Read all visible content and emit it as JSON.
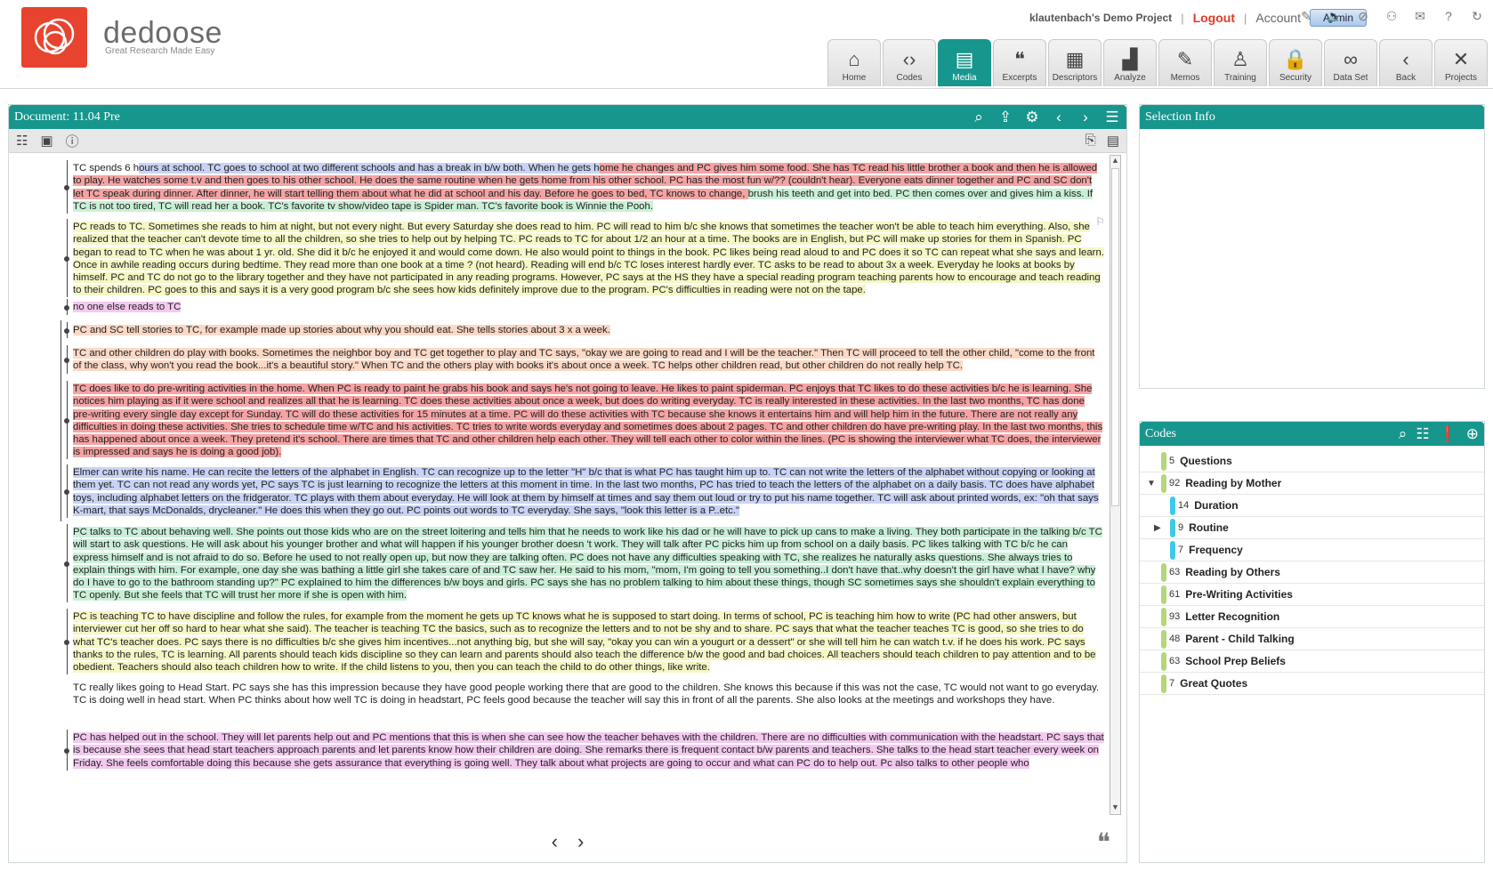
{
  "app": {
    "brand": "dedoose",
    "tagline": "Great Research Made Easy",
    "project": "klautenbach's Demo Project",
    "logout": "Logout",
    "account": "Account",
    "admin": "Admin",
    "accent_color": "#17968d",
    "logo_color": "#e8432f"
  },
  "nav": {
    "tabs": [
      {
        "label": "Home",
        "icon": "home-icon",
        "glyph": "⌂"
      },
      {
        "label": "Codes",
        "icon": "code-brackets-icon",
        "glyph": "‹›"
      },
      {
        "label": "Media",
        "icon": "media-icon",
        "glyph": "▤"
      },
      {
        "label": "Excerpts",
        "icon": "quote-icon",
        "glyph": "❝"
      },
      {
        "label": "Descriptors",
        "icon": "clipboard-icon",
        "glyph": "▦"
      },
      {
        "label": "Analyze",
        "icon": "bar-chart-icon",
        "glyph": "▟"
      },
      {
        "label": "Memos",
        "icon": "memo-icon",
        "glyph": "✎"
      },
      {
        "label": "Training",
        "icon": "person-icon",
        "glyph": "♙"
      },
      {
        "label": "Security",
        "icon": "lock-icon",
        "glyph": "🔒"
      },
      {
        "label": "Data Set",
        "icon": "binoculars-icon",
        "glyph": "∞"
      },
      {
        "label": "Back",
        "icon": "back-arrow-icon",
        "glyph": "‹"
      },
      {
        "label": "Projects",
        "icon": "projects-icon",
        "glyph": "✕"
      }
    ]
  },
  "document": {
    "title": "Document: 11.04 Pre",
    "paragraphs": [
      {
        "segments": [
          {
            "t": "TC spends 6 h",
            "c": "none"
          },
          {
            "t": "ours at school.  TC goes to school at two different schools and has a break in b/w both.  When he gets h",
            "c": "#c8d3f5"
          },
          {
            "t": "ome he changes and PC gives him some food.  She has TC read his little brother a book and then he is allowed to play.  He watches some t.v and then goes to his other school.  He does the same routine when he gets home from his other school.  PC has the most fun w/?? (couldn't hear).  Everyone eats dinner together and PC and SC don't let TC speak during dinner.  After dinner, he will start telling them about what he did at school and his day.  Before he goes to bed, TC knows to change, ",
            "c": "#f5a3a3"
          },
          {
            "t": "brush his teeth and get into bed.  PC then comes over and gives him a kiss.  If TC is not too tired, TC will read her a book.  TC's favorite tv show/video tape is Spider man.  TC's favorite book is Winnie the Pooh.",
            "c": "#c9f0d6"
          }
        ]
      },
      {
        "segments": [
          {
            "t": "PC reads to TC.  Sometimes she reads to him at night,  but not every night.  But every Saturday she does read to him.  PC will read to him b/c she knows that sometimes the teacher won't be able to teach him everything.  Also, she realized that the teacher can't devote time to all the children, so she tries to help out by helping TC.  PC reads to TC for about 1/2 an hour at a time.  The books are in English, but PC will make up stories for them in Spanish.  PC began to read to TC when he was about 1 yr. old.  She did it b/c he enjoyed it and would come down.  He also would point to things in the book.  PC likes being read aloud to and PC does it so TC can repeat what she says and learn.  Once in awhile reading occurs during bedtime.  They read more than one book at a time ? (not heard).  Reading will end b/c TC loses interest hardly ever.  TC asks to be read to about 3x a week.  Everyday he looks at books by himself.  PC and TC do not go to the library together and they have not participated in any reading programs.  However, PC says at the HS they have a special reading program teaching parents how to encourage and teach reading to their children.  PC goes to this and says it is a very good program b/c she sees how kids definitely improve due to the program.  PC's difficulties in reading were not on the tape.",
            "c": "#f6f7c4"
          }
        ]
      },
      {
        "segments": [
          {
            "t": "no one else reads to TC",
            "c": "#f3c9f0"
          }
        ]
      },
      {
        "segments": [
          {
            "t": "PC and SC tell stories to TC, for example made up stories about why you should eat.  She tells stories about 3 x a week.",
            "c": "#fbd9c6"
          }
        ]
      },
      {
        "segments": [
          {
            "t": "TC and other children do play with books.  Sometimes the neighbor boy and TC get together to play and TC says, \"okay we are going to read and I will be the teacher.\"  Then TC will proceed to tell the other child, \"come to the front of the class, why won't you read the book...it's a beautiful story.\"  When TC and the others play with books it's about once a week.  TC helps other children read, but other children do not really help TC.",
            "c": "#fbd9c6"
          }
        ]
      },
      {
        "segments": [
          {
            "t": "TC does like to do pre-writing activities in the home.  When PC is ready to paint he grabs his book and says he's not going to leave.  He likes to paint spiderman.  PC enjoys that TC likes to do these activities b/c he is learning.  She notices him playing as if it were school and realizes all that he is learning.  TC does these activities about once a week, but does do writing everyday.  TC is really interested in these activities.  In the last two months, TC has done pre-writing every single day except for Sunday.  TC will do these activities for 15 minutes at a time.  PC will do these activities with TC because she knows it entertains him and will help him in the future.  There are not really any difficulties in doing these activities.  She tries to schedule time w/TC and his activities.  TC tries to write words everyday and sometimes does about 2 pages.  TC and other children do have pre-writing play.  In the last two months, this has happened about once a week.  They pretend it's school.  There are times that TC and other children help each other.  They will tell each other to color within the lines.  (PC is showing the interviewer what TC does, the interviewer is impressed and says he is doing a good job).",
            "c": "#f5a3a3"
          }
        ]
      },
      {
        "segments": [
          {
            "t": "Elmer can write his name.  He can recite the letters of the alphabet in English.  TC can recognize up to the letter \"H\" b/c that is what PC has taught him up to.  TC can not write the letters of the alphabet without copying or looking at them yet.  TC can not read any words yet, PC says TC is just learning to recognize the letters at this moment in time.  In the last two months, PC has tried to teach the letters of the alphabet on a daily basis.  TC does have alphabet toys, including alphabet letters on the fridgerator.  TC plays with them about everyday.  He will look at them by himself at times and say them out loud or try to put his name together.  TC will ask about printed words, ex: \"oh that says K-mart, that says McDonalds, drycleaner.\"  He does this when they go out.  PC points out words to TC everyday.  She says, \"look this letter is a P..etc.\"",
            "c": "#c8d3f5"
          }
        ]
      },
      {
        "segments": [
          {
            "t": "PC talks to TC about behaving well.  She points out those kids who are on the street loitering and tells him that he needs to work like his dad or he will have to pick up cans to make a living.  They both participate in the talking b/c TC will start to ask questions.  He will ask about his younger brother and what will happen if his younger brother doesn 't work.  They will talk after PC picks him up from school on a daily basis.  PC likes talking with TC b/c he can express himself and is not afraid to do so.  Before he used to not really open up, but now they are talking often.  PC does not have any difficulties speaking with TC, she realizes he naturally asks questions.  She always tries to explain things with him.  For example, one day she was bathing a little girl she takes care of and TC saw her.  He said to his mom, \"mom, I'm going to tell you something..I don't have that..why doesn't the girl have what I have? why do I have to go to the bathroom standing up?\"  PC explained to him the differences b/w boys and girls.  PC says she has no problem talking to him about these things, though SC sometimes says she shouldn't explain everything to TC openly.  But she feels that TC will trust her more if she is open with him.",
            "c": "#c9f0d6"
          }
        ]
      },
      {
        "segments": [
          {
            "t": "PC is teaching TC to have discipline and follow the rules, for example from the moment he gets up TC knows what he is supposed to start doing.  In terms of school, PC is teaching him how to write (PC had other answers, but interviewer cut her off so hard to hear what she said).  The teacher is teaching TC the basics, such as to recognize the letters and to not be shy and to share.  PC says that what the teacher teaches TC is good, so she tries to do what TC's teacher does.  PC says there is no difficulties b/c she gives him incentives...not anything big, but she will say, \"okay you can win a yougurt or a dessert\" or she will tell him he can watch t.v. if he does his work. PC says thanks to the rules, TC is learning.  All parents should teach kids discipline so they can learn and parents should also teach the difference b/w the good and bad choices.  All teachers should teach children to pay attention and to be obedient.  Teachers should also teach children how to write.  If the child listens to you, then you can teach the child to do other things, like write.",
            "c": "#f6f7c4"
          }
        ]
      },
      {
        "segments": [
          {
            "t": "TC really likes going to Head Start.  PC says she has this impression because they have good people working there that are good to the children.  She knows this because if this was not the case, TC would not want to go everyday.  TC is doing well in head start.  When PC thinks about how well TC is doing in headstart, PC feels good because the teacher will say this in front of all the parents.  She also looks at the meetings and workshops they have.",
            "c": "none"
          }
        ]
      },
      {
        "segments": [
          {
            "t": "PC has helped out in the school.  They will let parents help out and PC mentions that this is when she can see how the teacher behaves with the children.  There are no difficulties with communication with the headstart.  PC says that is because she sees that head start teachers approach parents and let parents know how their children are doing.  She remarks there is frequent contact b/w parents and teachers.  She talks to the head start teacher every week on Friday.  She feels comfortable doing this because she gets assurance that everything is going well.  They talk about what projects are going to occur and what can PC do to help out.  Pc also talks to other people who",
            "c": "#f3c9f0"
          }
        ]
      }
    ]
  },
  "selection": {
    "title": "Selection Info"
  },
  "codes": {
    "title": "Codes",
    "items": [
      {
        "count": "5",
        "name": "Questions",
        "color": "#b5d67a",
        "level": 0,
        "expander": ""
      },
      {
        "count": "92",
        "name": "Reading by Mother",
        "color": "#b5d67a",
        "level": 0,
        "expander": "▼"
      },
      {
        "count": "14",
        "name": "Duration",
        "color": "#3ec9e8",
        "level": 1,
        "expander": ""
      },
      {
        "count": "9",
        "name": "Routine",
        "color": "#3ec9e8",
        "level": 1,
        "expander": "▶"
      },
      {
        "count": "7",
        "name": "Frequency",
        "color": "#3ec9e8",
        "level": 1,
        "expander": ""
      },
      {
        "count": "63",
        "name": "Reading by Others",
        "color": "#b5d67a",
        "level": 0,
        "expander": ""
      },
      {
        "count": "61",
        "name": "Pre-Writing Activities",
        "color": "#b5d67a",
        "level": 0,
        "expander": ""
      },
      {
        "count": "93",
        "name": "Letter Recognition",
        "color": "#b5d67a",
        "level": 0,
        "expander": ""
      },
      {
        "count": "48",
        "name": "Parent - Child Talking",
        "color": "#b5d67a",
        "level": 0,
        "expander": ""
      },
      {
        "count": "63",
        "name": "School Prep Beliefs",
        "color": "#b5d67a",
        "level": 0,
        "expander": ""
      },
      {
        "count": "7",
        "name": "Great Quotes",
        "color": "#b5d67a",
        "level": 0,
        "expander": ""
      }
    ]
  }
}
